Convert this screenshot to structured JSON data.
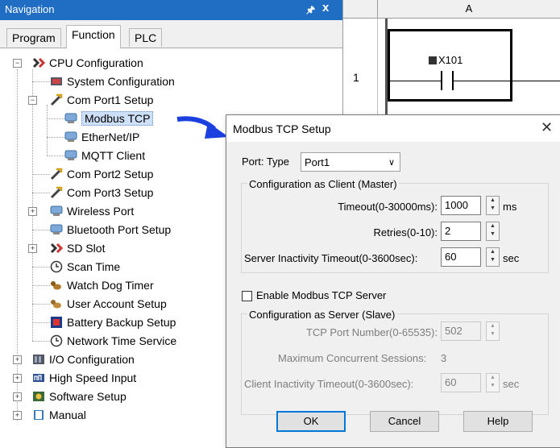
{
  "nav": {
    "title": "Navigation",
    "pin_glyph": "↕",
    "close_glyph": "x",
    "tabs": [
      {
        "label": "Program"
      },
      {
        "label": "Function"
      },
      {
        "label": "PLC"
      }
    ],
    "tree": [
      {
        "label": "CPU Configuration",
        "icon": "cpu-config-icon"
      },
      {
        "label": "System Configuration",
        "icon": "system-config-icon"
      },
      {
        "label": "Com Port1 Setup",
        "icon": "com-port-icon"
      },
      {
        "label": "Modbus TCP",
        "icon": "network-icon",
        "selected": true
      },
      {
        "label": "EtherNet/IP",
        "icon": "network-icon"
      },
      {
        "label": "MQTT Client",
        "icon": "network-icon"
      },
      {
        "label": "Com Port2 Setup",
        "icon": "com-port-icon"
      },
      {
        "label": "Com Port3 Setup",
        "icon": "com-port-icon"
      },
      {
        "label": "Wireless Port",
        "icon": "network-icon"
      },
      {
        "label": "Bluetooth Port Setup",
        "icon": "network-icon"
      },
      {
        "label": "SD Slot",
        "icon": "sd-slot-icon"
      },
      {
        "label": "Scan Time",
        "icon": "clock-icon"
      },
      {
        "label": "Watch Dog Timer",
        "icon": "watchdog-icon"
      },
      {
        "label": "User Account Setup",
        "icon": "user-account-icon"
      },
      {
        "label": "Battery Backup Setup",
        "icon": "battery-icon"
      },
      {
        "label": "Network Time Service",
        "icon": "clock-icon"
      },
      {
        "label": "I/O Configuration",
        "icon": "io-config-icon"
      },
      {
        "label": "High Speed Input",
        "icon": "high-speed-input-icon"
      },
      {
        "label": "Software Setup",
        "icon": "software-setup-icon"
      },
      {
        "label": "Manual",
        "icon": "manual-book-icon"
      }
    ]
  },
  "ladder": {
    "column": "A",
    "row": "1",
    "contact": "X101"
  },
  "dialog": {
    "title": "Modbus TCP Setup",
    "close_glyph": "✕",
    "port_type_label": "Port: Type",
    "port_type_value": "Port1",
    "client_group": "Configuration as Client (Master)",
    "timeout_label": "Timeout(0-30000ms):",
    "timeout_value": "1000",
    "timeout_unit": "ms",
    "retries_label": "Retries(0-10):",
    "retries_value": "2",
    "server_inactivity_label": "Server Inactivity Timeout(0-3600sec):",
    "server_inactivity_value": "60",
    "server_inactivity_unit": "sec",
    "enable_server_label": "Enable Modbus TCP Server",
    "enable_server_checked": false,
    "server_group": "Configuration as Server (Slave)",
    "tcp_port_label": "TCP Port Number(0-65535):",
    "tcp_port_value": "502",
    "max_sessions_label": "Maximum Concurrent Sessions:",
    "max_sessions_value": "3",
    "client_inactivity_label": "Client Inactivity Timeout(0-3600sec):",
    "client_inactivity_value": "60",
    "client_inactivity_unit": "sec",
    "ok": "OK",
    "cancel": "Cancel",
    "help": "Help"
  },
  "colors": {
    "title_bar": "#1f6ec3",
    "arrow": "#1c3fe0",
    "default_button_border": "#0078d7",
    "selection": "#cde0f7"
  }
}
